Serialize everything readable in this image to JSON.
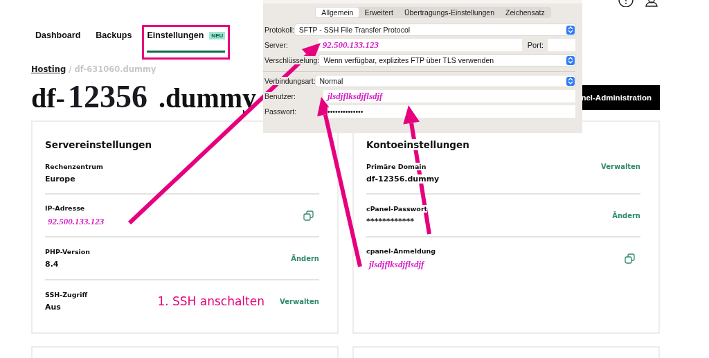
{
  "header": {
    "icons": [
      {
        "kind": "info"
      },
      {
        "kind": "user"
      }
    ]
  },
  "nav": {
    "tabs": [
      {
        "label": "Dashboard",
        "selected": false
      },
      {
        "label": "Backups",
        "selected": false
      },
      {
        "label": "Einstellungen",
        "selected": true,
        "badge": "NEU"
      }
    ]
  },
  "breadcrumb": {
    "link": "Hosting",
    "separator": "/",
    "current": "df-631060.dummy"
  },
  "heading": {
    "prefix": "df-",
    "number": "12356",
    "suffix": ".dummy"
  },
  "admin_button": "nel-Administration",
  "cards": [
    {
      "title": "Servereinstellungen",
      "rows": [
        {
          "label": "Rechenzentrum",
          "value": "Europe",
          "highlighted": false
        },
        {
          "label": "IP-Adresse",
          "value": "92.500.133.123",
          "highlighted": true,
          "action": {
            "kind": "copy"
          }
        },
        {
          "label": "PHP-Version",
          "value": "8.4",
          "highlighted": false,
          "action": {
            "kind": "link",
            "label": "Ändern"
          }
        },
        {
          "label": "SSH-Zugriff",
          "value": "Aus",
          "highlighted": false,
          "note": "1. SSH anschalten",
          "action": {
            "kind": "link",
            "label": "Verwalten"
          }
        }
      ]
    },
    {
      "title": "Kontoeinstellungen",
      "rows": [
        {
          "label": "Primäre Domain",
          "value": "df-12356.dummy",
          "highlighted": false,
          "action": {
            "kind": "link",
            "label": "Verwalten"
          }
        },
        {
          "label": "cPanel-Passwort",
          "value": "************",
          "highlighted": false,
          "action": {
            "kind": "link",
            "label": "Ändern"
          }
        },
        {
          "label": "cpanel-Anmeldung",
          "value": "jlsdjflksdjflsdjf",
          "highlighted": true,
          "action": {
            "kind": "copy"
          }
        }
      ]
    }
  ],
  "dialog": {
    "tabs": [
      {
        "label": "Allgemein",
        "selected": true
      },
      {
        "label": "Erweitert",
        "selected": false
      },
      {
        "label": "Übertragungs-Einstellungen",
        "selected": false
      },
      {
        "label": "Zeichensatz",
        "selected": false
      }
    ],
    "fields": [
      {
        "kind": "select",
        "label": "Protokoll:",
        "value": "SFTP - SSH File Transfer Protocol",
        "highlighted": false
      },
      {
        "kind": "text",
        "label": "Server:",
        "value": "92.500.133.123",
        "highlighted": true,
        "port_label": "Port:"
      },
      {
        "kind": "select",
        "label": "Verschlüsselung:",
        "value": "Wenn verfügbar, explizites FTP über TLS verwenden",
        "highlighted": false
      },
      {
        "kind": "select",
        "label": "Verbindungsart:",
        "value": "Normal",
        "highlighted": false,
        "divider_before": true
      },
      {
        "kind": "text",
        "label": "Benutzer:",
        "value": "jlsdjflksdjflsdjf",
        "highlighted": true
      },
      {
        "kind": "text",
        "label": "Passwort:",
        "value": "••••••••••••••",
        "highlighted": false
      }
    ]
  }
}
